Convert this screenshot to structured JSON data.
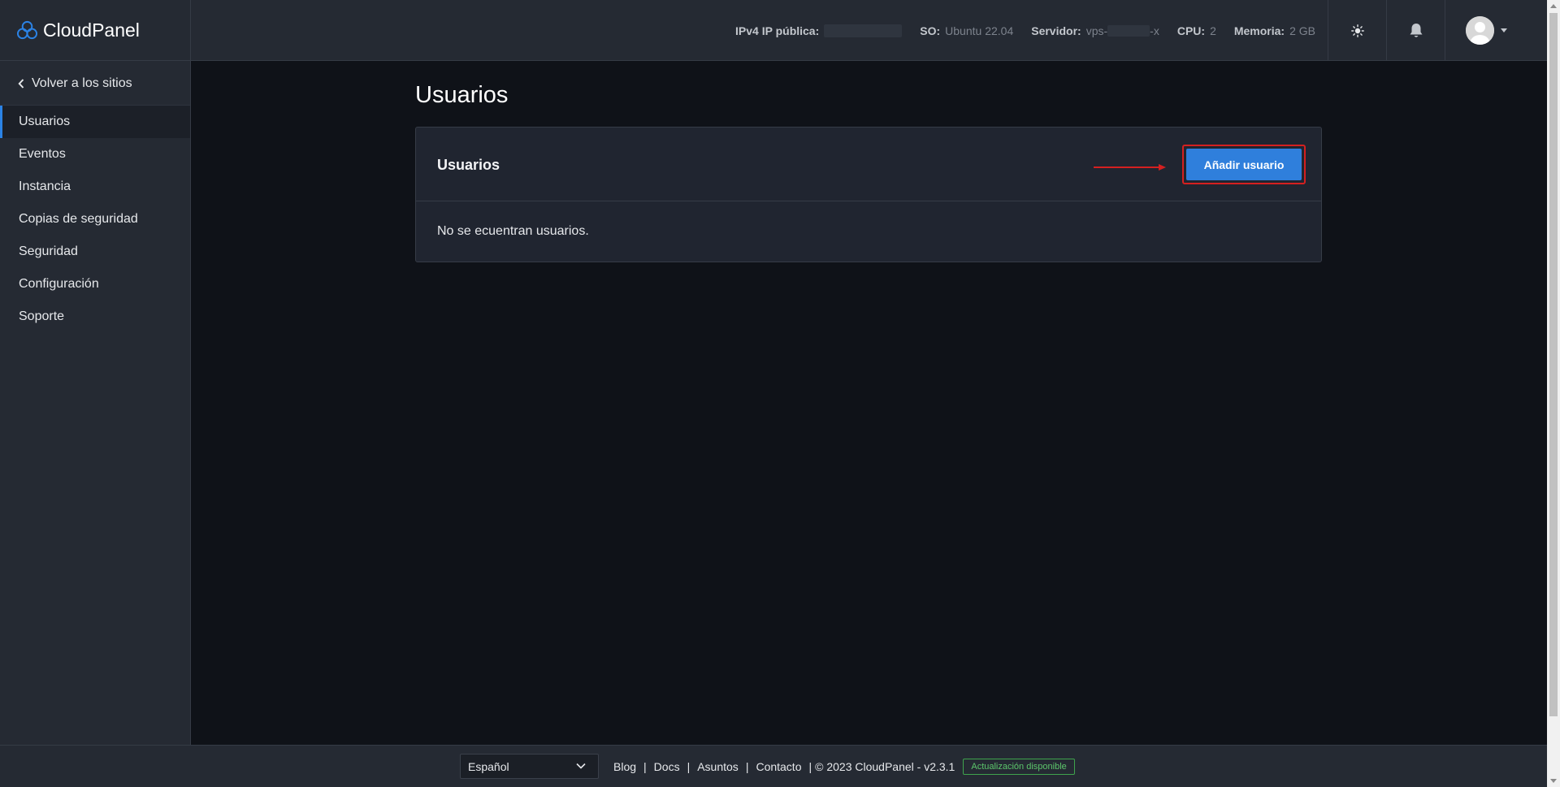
{
  "header": {
    "brand": "CloudPanel",
    "server_info": [
      {
        "key": "IPv4 IP pública:",
        "value": ""
      },
      {
        "key": "SO:",
        "value": "Ubuntu 22.04"
      },
      {
        "key": "Servidor:",
        "value_prefix": "vps-",
        "value_suffix": "-x"
      },
      {
        "key": "CPU:",
        "value": "2"
      },
      {
        "key": "Memoria:",
        "value": "2 GB"
      }
    ],
    "theme_icon": "sun-icon",
    "notifications_icon": "bell-icon",
    "avatar_icon": "user-avatar-icon"
  },
  "sidebar": {
    "back_label": "Volver a los sitios",
    "items": [
      {
        "label": "Usuarios",
        "active": true
      },
      {
        "label": "Eventos"
      },
      {
        "label": "Instancia"
      },
      {
        "label": "Copias de seguridad"
      },
      {
        "label": "Seguridad"
      },
      {
        "label": "Configuración"
      },
      {
        "label": "Soporte"
      }
    ]
  },
  "main": {
    "page_title": "Usuarios",
    "card_title": "Usuarios",
    "add_button_label": "Añadir usuario",
    "empty_message": "No se ecuentran usuarios."
  },
  "footer": {
    "language": "Español",
    "links": [
      "Blog",
      "Docs",
      "Asuntos",
      "Contacto"
    ],
    "copyright": "© 2023  CloudPanel  - v2.3.1",
    "update_badge": "Actualización disponible"
  },
  "colors": {
    "accent": "#2f7fdc",
    "highlight": "#d42020",
    "success": "#5cc56b",
    "background": "#0f1218",
    "panel": "#252a33"
  }
}
